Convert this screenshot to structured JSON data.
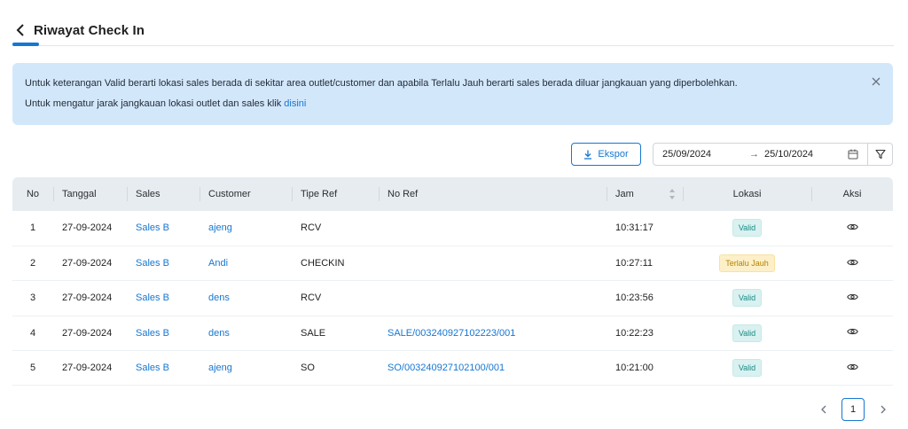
{
  "header": {
    "title": "Riwayat Check In"
  },
  "alert": {
    "line1": "Untuk keterangan Valid berarti lokasi sales berada di sekitar area outlet/customer dan apabila Terlalu Jauh berarti sales berada diluar jangkauan yang diperbolehkan.",
    "line2_prefix": "Untuk mengatur jarak jangkauan lokasi outlet dan sales klik ",
    "line2_link": "disini"
  },
  "toolbar": {
    "export_label": "Ekspor",
    "date_from": "25/09/2024",
    "date_to": "25/10/2024"
  },
  "table": {
    "columns": [
      "No",
      "Tanggal",
      "Sales",
      "Customer",
      "Tipe Ref",
      "No Ref",
      "Jam",
      "Lokasi",
      "Aksi"
    ],
    "rows": [
      {
        "no": "1",
        "tanggal": "27-09-2024",
        "sales": "Sales B",
        "customer": "ajeng",
        "tipe_ref": "RCV",
        "no_ref": "",
        "jam": "10:31:17",
        "lokasi": "Valid",
        "status": "valid"
      },
      {
        "no": "2",
        "tanggal": "27-09-2024",
        "sales": "Sales B",
        "customer": "Andi",
        "tipe_ref": "CHECKIN",
        "no_ref": "",
        "jam": "10:27:11",
        "lokasi": "Terlalu Jauh",
        "status": "far"
      },
      {
        "no": "3",
        "tanggal": "27-09-2024",
        "sales": "Sales B",
        "customer": "dens",
        "tipe_ref": "RCV",
        "no_ref": "",
        "jam": "10:23:56",
        "lokasi": "Valid",
        "status": "valid"
      },
      {
        "no": "4",
        "tanggal": "27-09-2024",
        "sales": "Sales B",
        "customer": "dens",
        "tipe_ref": "SALE",
        "no_ref": "SALE/003240927102223/001",
        "jam": "10:22:23",
        "lokasi": "Valid",
        "status": "valid"
      },
      {
        "no": "5",
        "tanggal": "27-09-2024",
        "sales": "Sales B",
        "customer": "ajeng",
        "tipe_ref": "SO",
        "no_ref": "SO/003240927102100/001",
        "jam": "10:21:00",
        "lokasi": "Valid",
        "status": "valid"
      }
    ]
  },
  "pagination": {
    "current_page": "1"
  },
  "colors": {
    "accent": "#1677d2",
    "alert_bg": "#d3e7fb",
    "valid": "#1a8a86",
    "far": "#b58206"
  },
  "icons": {
    "back": "chevron-left-icon",
    "close": "close-icon",
    "export": "download-icon",
    "calendar": "calendar-icon",
    "filter": "filter-icon",
    "view": "eye-icon",
    "sort": "sort-icon"
  }
}
